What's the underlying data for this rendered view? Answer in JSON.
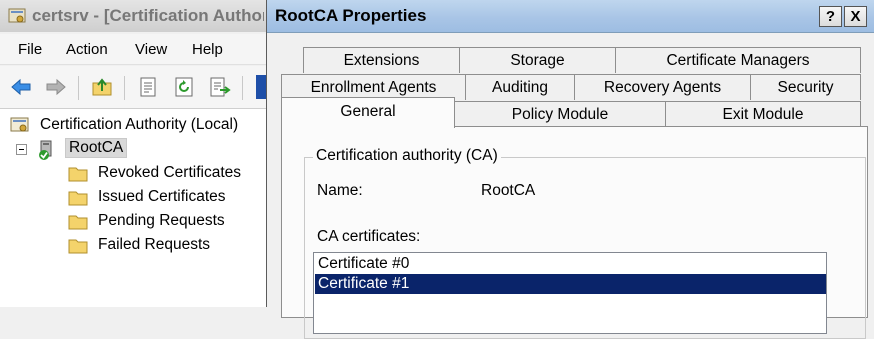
{
  "background_window": {
    "title": "certsrv - [Certification Authority (Local)\\RootCA]",
    "menu": [
      "File",
      "Action",
      "View",
      "Help"
    ],
    "toolbar_icons": [
      "back-icon",
      "forward-icon",
      "up-folder-icon",
      "properties-icon",
      "refresh-icon",
      "export-list-icon"
    ],
    "tree": {
      "root": "Certification Authority (Local)",
      "ca": "RootCA",
      "folders": [
        "Revoked Certificates",
        "Issued Certificates",
        "Pending Requests",
        "Failed Requests"
      ]
    }
  },
  "dialog": {
    "title": "RootCA Properties",
    "help_button": "?",
    "close_button": "X",
    "tabs_row1": [
      "Extensions",
      "Storage",
      "Certificate Managers"
    ],
    "tabs_row2": [
      "Enrollment Agents",
      "Auditing",
      "Recovery Agents",
      "Security"
    ],
    "tabs_row3": [
      "General",
      "Policy Module",
      "Exit Module"
    ],
    "active_tab": "General",
    "general": {
      "group_title": "Certification authority (CA)",
      "name_label": "Name:",
      "name_value": "RootCA",
      "certs_label": "CA certificates:",
      "certificates": [
        "Certificate #0",
        "Certificate #1"
      ],
      "selected_certificate": "Certificate #1"
    }
  },
  "colors": {
    "dialog_title_gradient": "#a9c5e6",
    "selection_bg": "#0a246a",
    "selection_fg": "#ffffff",
    "folder_yellow": "#f4d36b"
  }
}
